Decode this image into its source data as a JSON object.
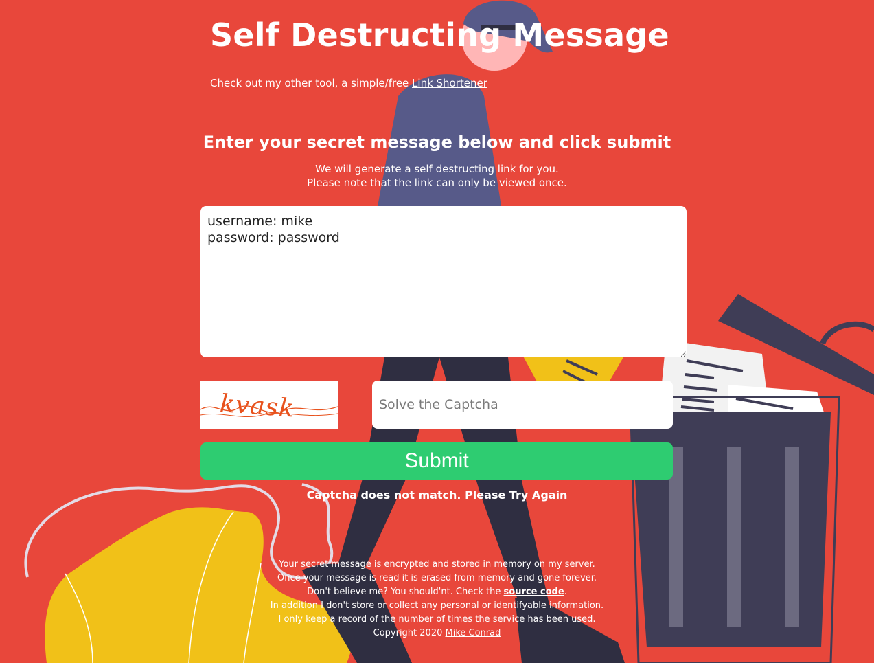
{
  "header": {
    "title": "Self Destructing Message",
    "promo_prefix": "Check out my other tool, a simple/free ",
    "promo_link": "Link Shortener"
  },
  "form": {
    "headline": "Enter your secret message below and click submit",
    "subtext_line1": "We will generate a self destructing link for you.",
    "subtext_line2": "Please note that the link can only be viewed once.",
    "message_value": "username: mike\npassword: password",
    "captcha_text": "kvask",
    "captcha_placeholder": "Solve the Captcha",
    "submit_label": "Submit",
    "error": "Captcha does not match. Please Try Again"
  },
  "footer": {
    "line1": "Your secret message is encrypted and stored in memory on my server.",
    "line2": "Once your message is read it is erased from memory and gone forever.",
    "line3_prefix": "Don't believe me? You should'nt. Check the ",
    "line3_link": "source code",
    "line3_suffix": ".",
    "line4": "In addition I don't store or collect any personal or identifyable information.",
    "line5": "I only keep a record of the number of times the service has been used.",
    "copyright_prefix": "Copyright 2020 ",
    "copyright_link": "Mike Conrad"
  },
  "colors": {
    "background": "#e8473b",
    "submit": "#2ecc71",
    "plant": "#f1c118",
    "trash": "#3f3d56",
    "skin": "#ffb6b6",
    "shirt": "#575a89"
  }
}
